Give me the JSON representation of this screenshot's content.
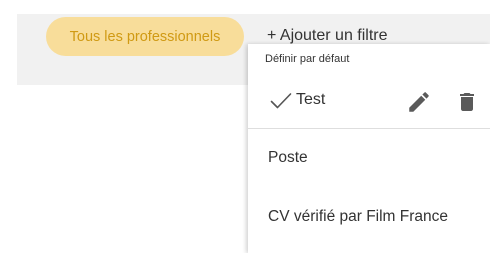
{
  "filters": {
    "all_chip_label": "Tous les professionnels",
    "add_filter_label": "+ Ajouter un filtre"
  },
  "dropdown": {
    "section_header": "Définir par défaut",
    "saved_filter": {
      "label": "Test",
      "check_icon": "checkmark-icon",
      "edit_icon": "pencil-icon",
      "delete_icon": "trash-icon"
    },
    "items": [
      {
        "label": "Poste"
      },
      {
        "label": "CV vérifié par Film France"
      }
    ]
  },
  "colors": {
    "chip_bg": "#f8dd9a",
    "chip_text": "#d09a14",
    "bar_bg": "#f1f1f1",
    "icon": "#5a5a5a"
  }
}
